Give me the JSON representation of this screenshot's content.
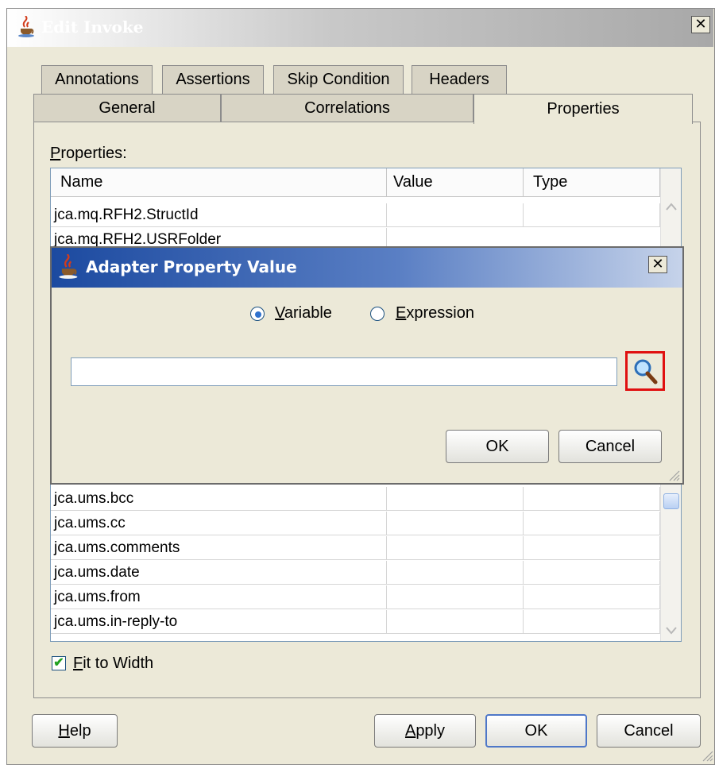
{
  "outer_dialog": {
    "title": "Edit Invoke",
    "tabs_back": [
      "Annotations",
      "Assertions",
      "Skip Condition",
      "Headers"
    ],
    "tabs_front": [
      "General",
      "Correlations",
      "Properties"
    ],
    "properties_label_rest": "roperties:",
    "properties_label_key": "P",
    "table": {
      "columns": [
        "Name",
        "Value",
        "Type"
      ],
      "rows_top": [
        "jca.mq.RFH2.StructId",
        "jca.mq.RFH2.USRFolder"
      ],
      "rows_bottom": [
        "jca.ums.bcc",
        "jca.ums.cc",
        "jca.ums.comments",
        "jca.ums.date",
        "jca.ums.from",
        "jca.ums.in-reply-to"
      ]
    },
    "fit_to_width": {
      "key": "F",
      "rest": "it to Width",
      "checked": true
    },
    "buttons": {
      "help_key": "H",
      "help_rest": "elp",
      "apply_key": "A",
      "apply_rest": "pply",
      "ok": "OK",
      "cancel": "Cancel"
    }
  },
  "inner_dialog": {
    "title": "Adapter Property Value",
    "radio_variable_key": "V",
    "radio_variable_rest": "ariable",
    "radio_expression_key": "E",
    "radio_expression_rest": "xpression",
    "selected": "Variable",
    "value_input": "",
    "ok": "OK",
    "cancel": "Cancel"
  },
  "icons": [
    "java-cup-icon",
    "search-icon",
    "close-icon",
    "check-icon",
    "scroll-up-icon",
    "scroll-down-icon"
  ],
  "colors": {
    "inner_title_start": "#1c4aa0",
    "highlight_box": "#e01010",
    "dialog_bg": "#ece9d8"
  }
}
